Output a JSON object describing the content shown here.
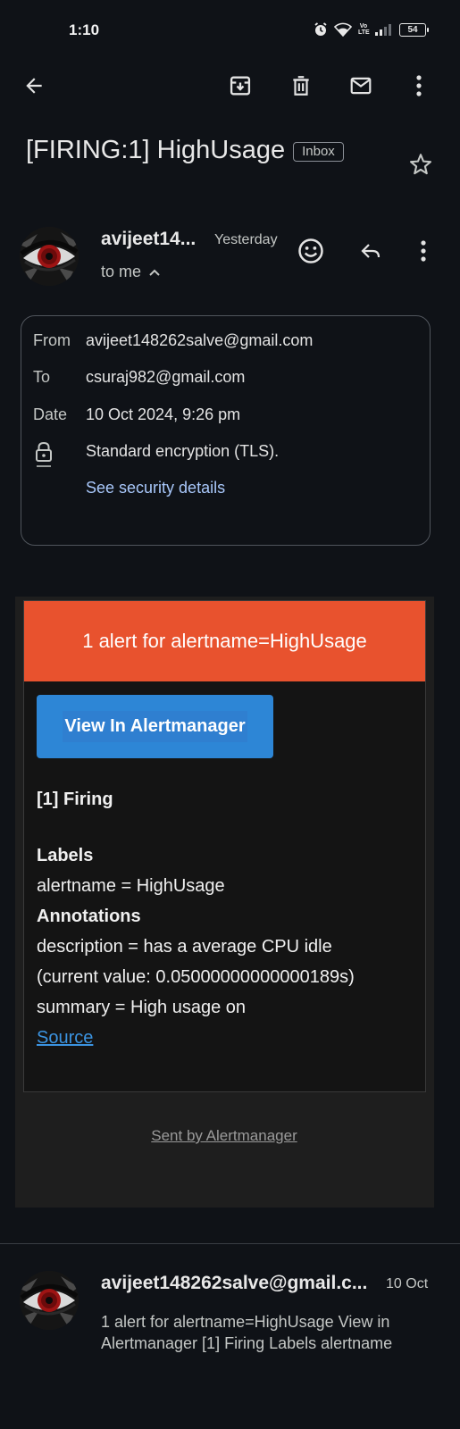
{
  "status_bar": {
    "time": "1:10",
    "battery": "54",
    "network_label": "LTE"
  },
  "toolbar": {
    "icons": [
      "back-arrow-icon",
      "archive-icon",
      "delete-icon",
      "mark-unread-icon",
      "more-vert-icon"
    ]
  },
  "email": {
    "subject": "[FIRING:1] HighUsage",
    "label": "Inbox",
    "sender_short": "avijeet14...",
    "time": "Yesterday",
    "recipient_summary": "to me",
    "details": {
      "from_label": "From",
      "from_value": "avijeet148262salve@gmail.com",
      "to_label": "To",
      "to_value": "csuraj982@gmail.com",
      "date_label": "Date",
      "date_value": "10 Oct 2024, 9:26 pm",
      "encryption": "Standard encryption (TLS).",
      "security_link": "See security details"
    },
    "body": {
      "header": "1 alert for alertname=HighUsage",
      "button": "View In Alertmanager",
      "firing": "[1] Firing",
      "labels_heading": "Labels",
      "label_line": "alertname = HighUsage",
      "annotations_heading": "Annotations",
      "description_line1": "description = has a average CPU idle",
      "description_line2": "(current value: 0.05000000000000189s)",
      "summary_line": "summary = High usage on",
      "source_link": "Source",
      "sent_by": "Sent by Alertmanager"
    },
    "colors": {
      "alert_header": "#e8522e",
      "button": "#2d86d6",
      "link": "#a8c7fa"
    }
  },
  "next_email": {
    "sender": "avijeet148262salve@gmail.c...",
    "date": "10 Oct",
    "snippet": "1 alert for alertname=HighUsage View in Alertmanager [1] Firing Labels alertname"
  }
}
